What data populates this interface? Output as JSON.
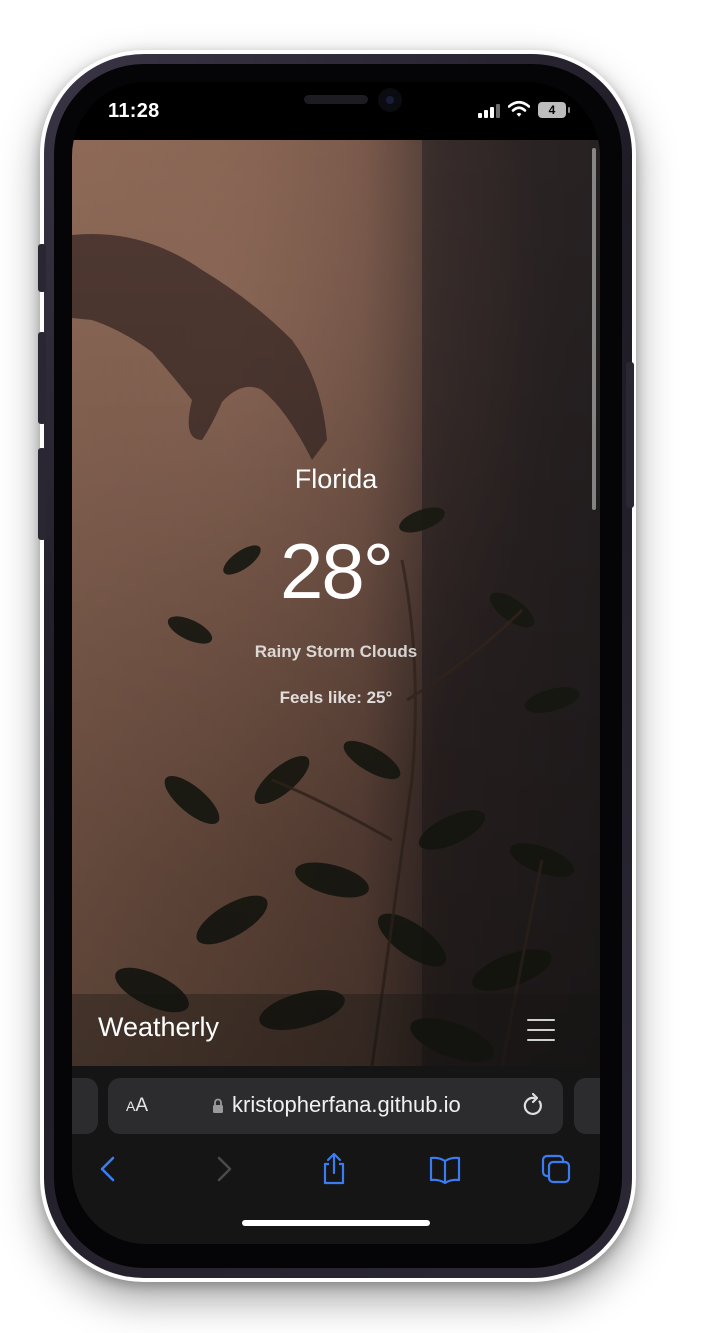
{
  "status_bar": {
    "time": "11:28",
    "battery_level": "4"
  },
  "weather": {
    "city": "Florida",
    "temperature": "28°",
    "condition": "Rainy Storm Clouds",
    "feels_like": "Feels like: 25°"
  },
  "site_nav": {
    "brand": "Weatherly"
  },
  "browser": {
    "text_size_label_small": "A",
    "text_size_label_large": "A",
    "url": "kristopherfana.github.io"
  },
  "colors": {
    "toolbar_accent": "#3a7df2",
    "toolbar_disabled": "#4a4a4e"
  },
  "icons": [
    "signal-icon",
    "wifi-icon",
    "battery-icon",
    "menu-icon",
    "lock-icon",
    "reload-icon",
    "back-icon",
    "forward-icon",
    "share-icon",
    "bookmarks-icon",
    "tabs-icon"
  ]
}
